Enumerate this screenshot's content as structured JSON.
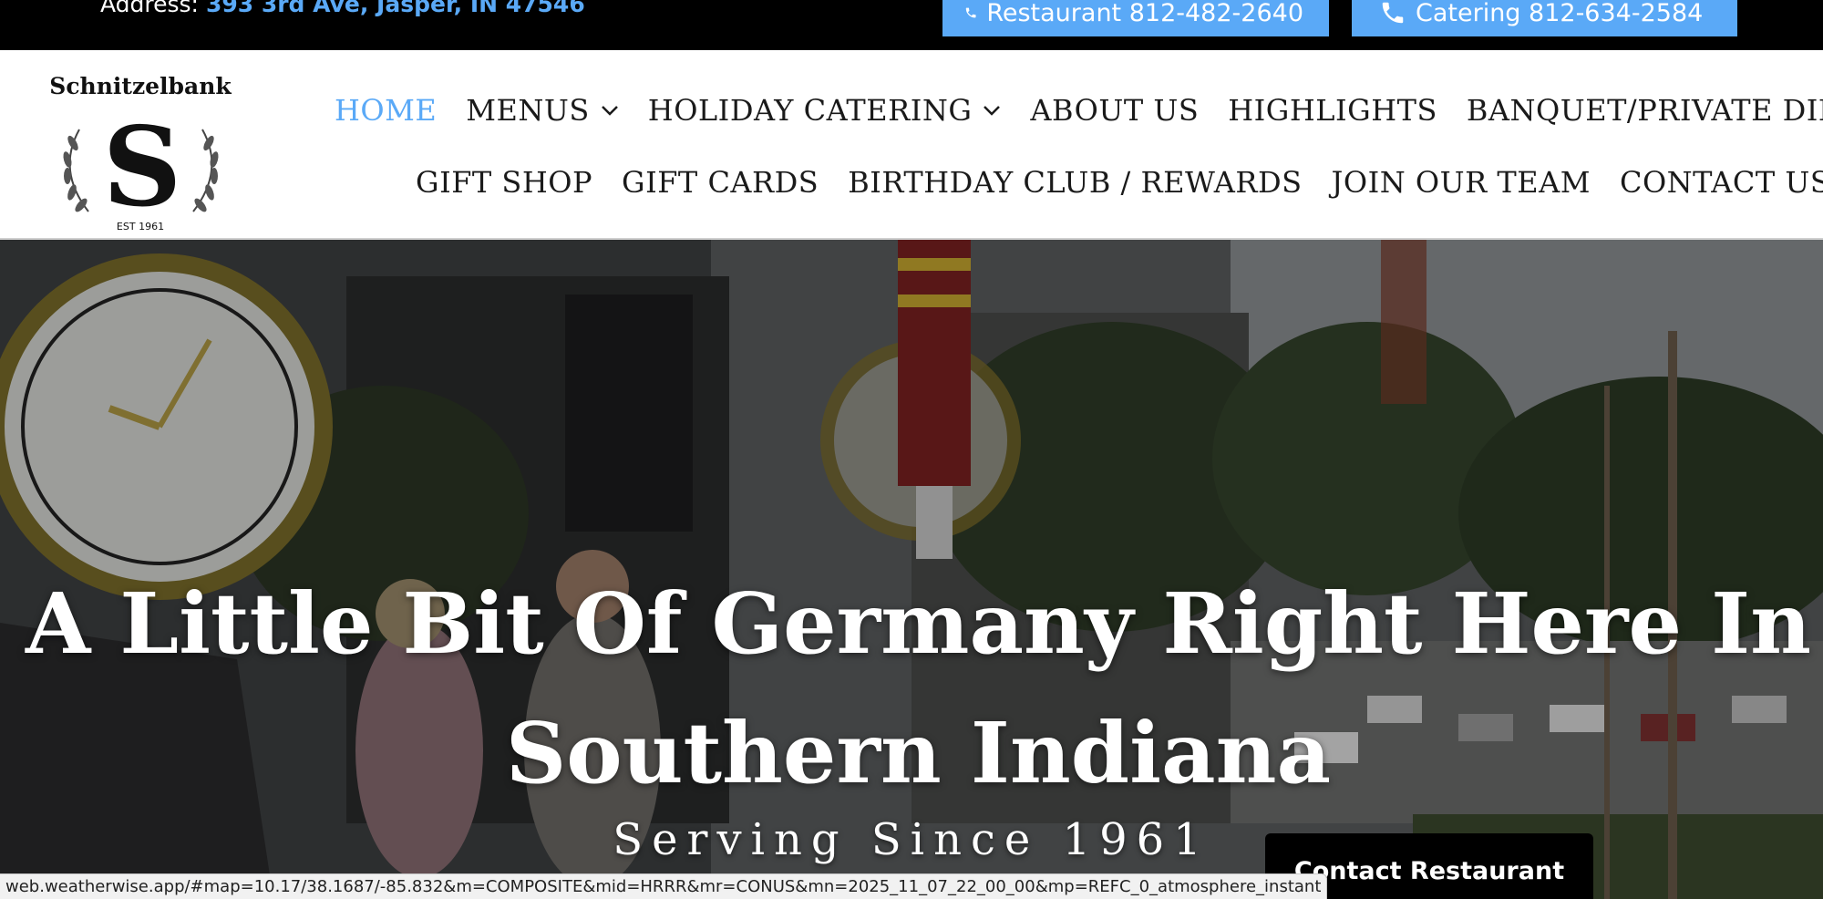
{
  "topbar": {
    "address_label": "Address:",
    "address_value": "393 3rd Ave, Jasper, IN 47546",
    "restaurant_phone": "Restaurant 812-482-2640",
    "catering_phone": "Catering 812-634-2584",
    "accent_color": "#5aa9f7"
  },
  "logo": {
    "brand": "Schnitzelbank",
    "monogram": "S",
    "established": "EST 1961"
  },
  "nav": {
    "row1": [
      {
        "label": "HOME",
        "active": true,
        "dropdown": false
      },
      {
        "label": "MENUS",
        "active": false,
        "dropdown": true
      },
      {
        "label": "HOLIDAY CATERING",
        "active": false,
        "dropdown": true
      },
      {
        "label": "ABOUT US",
        "active": false,
        "dropdown": false
      },
      {
        "label": "HIGHLIGHTS",
        "active": false,
        "dropdown": false
      },
      {
        "label": "BANQUET/PRIVATE DINING",
        "active": false,
        "dropdown": false
      }
    ],
    "row2": [
      {
        "label": "GIFT SHOP"
      },
      {
        "label": "GIFT CARDS"
      },
      {
        "label": "BIRTHDAY CLUB / REWARDS"
      },
      {
        "label": "JOIN OUR TEAM"
      },
      {
        "label": "CONTACT US"
      }
    ]
  },
  "hero": {
    "title_line1": "A Little Bit Of Germany Right Here In",
    "title_line2": "Southern Indiana",
    "subtitle": "Serving Since 1961",
    "cta_label": "Contact Restaurant"
  },
  "statusbar": {
    "url": "web.weatherwise.app/#map=10.17/38.1687/-85.832&m=COMPOSITE&mid=HRRR&mr=CONUS&mn=2025_11_07_22_00_00&mp=REFC_0_atmosphere_instant"
  }
}
